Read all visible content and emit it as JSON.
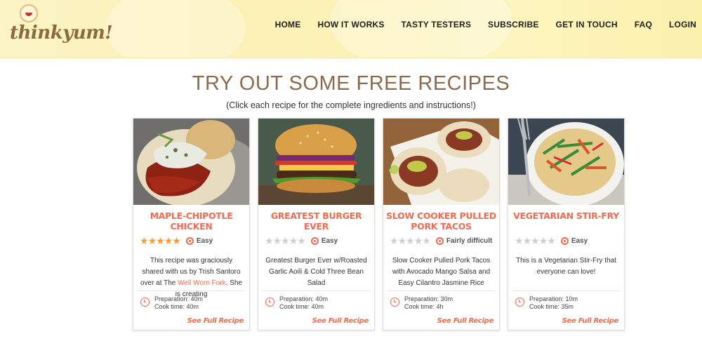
{
  "header": {
    "logo_text": "thinkyum!",
    "nav": [
      "HOME",
      "HOW IT WORKS",
      "TASTY TESTERS",
      "SUBSCRIBE",
      "GET IN TOUCH",
      "FAQ",
      "LOGIN"
    ]
  },
  "main": {
    "title": "TRY OUT SOME FREE RECIPES",
    "subtitle": "(Click each recipe for the complete ingredients and instructions!)"
  },
  "recipes": [
    {
      "title": "MAPLE-CHIPOTLE CHICKEN",
      "rating": 5,
      "difficulty": "Easy",
      "desc_before": "This recipe was graciously shared with us by Trish Santoro over at The ",
      "desc_link": "Well Worn Fork",
      "desc_after": ". She is creating",
      "prep": "Preparation: 40m",
      "cook": "Cook time: 40m",
      "cta": "See Full Recipe"
    },
    {
      "title": "GREATEST BURGER EVER",
      "rating": 0,
      "difficulty": "Easy",
      "desc_before": "Greatest Burger Ever w/Roasted Garlic Aoili & Cold Three Bean Salad",
      "desc_link": "",
      "desc_after": "",
      "prep": "Preparation: 40m",
      "cook": "Cook time: 40m",
      "cta": "See Full Recipe"
    },
    {
      "title": "SLOW COOKER PULLED PORK TACOS",
      "rating": 0,
      "difficulty": "Fairly difficult",
      "desc_before": "Slow Cooker Pulled Pork Tacos with Avocado Mango Salsa and Easy Cilantro Jasmine Rice",
      "desc_link": "",
      "desc_after": "",
      "prep": "Preparation: 30m",
      "cook": "Cook time: 4h",
      "cta": "See Full Recipe"
    },
    {
      "title": "VEGETARIAN STIR-FRY",
      "rating": 0,
      "difficulty": "Easy",
      "desc_before": "This is a Vegetarian Stir-Fry that everyone can love!",
      "desc_link": "",
      "desc_after": "",
      "prep": "Preparation: 10m",
      "cook": "Cook time: 35m",
      "cta": "See Full Recipe"
    }
  ],
  "colors": {
    "accent": "#ef6c51",
    "title": "#8b6a4e",
    "star": "#f39c3c",
    "header_bg": "#fbf3c4"
  }
}
